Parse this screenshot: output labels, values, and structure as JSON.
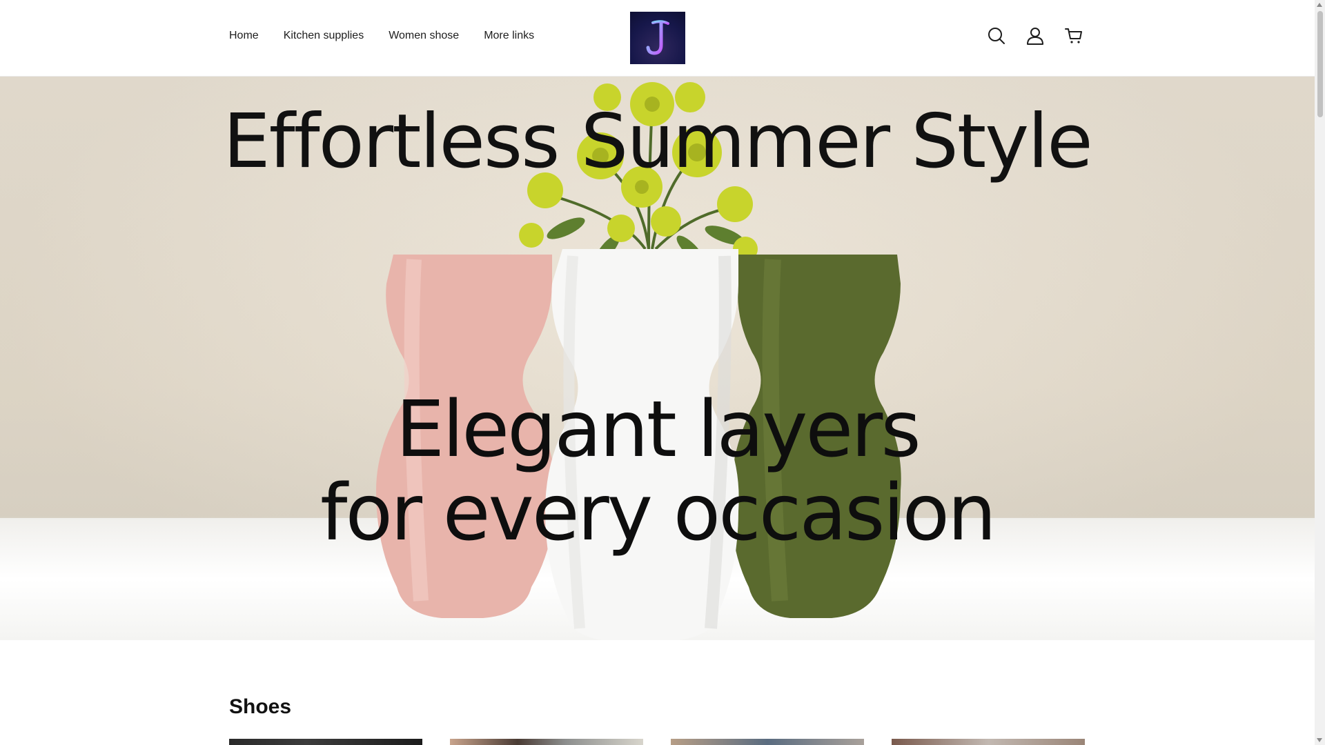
{
  "nav": {
    "items": [
      {
        "label": "Home"
      },
      {
        "label": "Kitchen supplies"
      },
      {
        "label": "Women shose"
      },
      {
        "label": "More links"
      }
    ]
  },
  "header_icons": [
    "search-icon",
    "account-icon",
    "cart-icon"
  ],
  "hero": {
    "title": "Effortless Summer Style",
    "subtitle_line1": "Elegant layers",
    "subtitle_line2": "for every occasion"
  },
  "section": {
    "title": "Shoes"
  },
  "colors": {
    "logo_bg": "#16174a",
    "vase_pink": "#e9b6ae",
    "vase_white": "#f7f7f7",
    "vase_green": "#5b6a30",
    "flowers": "#c6d22a"
  }
}
